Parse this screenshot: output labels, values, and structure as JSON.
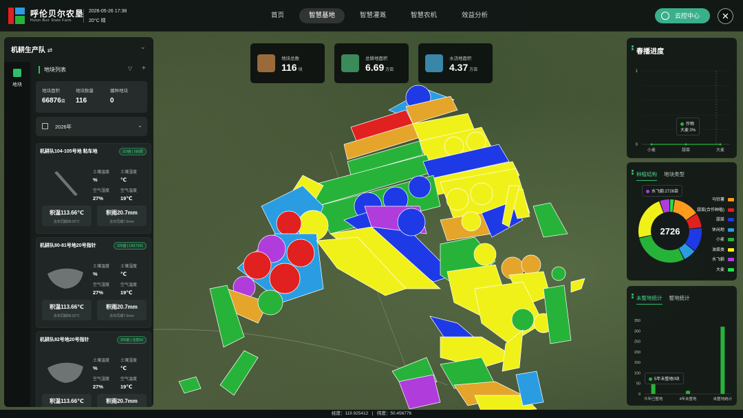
{
  "header": {
    "brand_cn": "呼伦贝尔农垦",
    "brand_en": "Hulun Buir State Farm",
    "datetime": "2026-05-26 17:38",
    "weather": "20°C 晴",
    "nav": [
      "首页",
      "智慧基地",
      "智慧灌溉",
      "智慧农机",
      "效益分析"
    ],
    "active_nav": "智慧基地",
    "cloud_label": "云控中心",
    "close_symbol": "✕"
  },
  "left": {
    "team_title": "机耕生产队",
    "sidebar_tab": "地块",
    "list_title": "地块列表",
    "stats": [
      {
        "label": "地块面积",
        "value": "66876",
        "unit": "亩"
      },
      {
        "label": "地块数量",
        "value": "116",
        "unit": ""
      },
      {
        "label": "播种地块",
        "value": "0",
        "unit": ""
      }
    ],
    "year": "2026年",
    "cards": [
      {
        "title": "机耕队104-105号地 粘车地",
        "badge": "119亩 | 0|0|局",
        "soil_temp_label": "土壤温度",
        "soil_temp": "%",
        "soil_hum_label": "土壤湿度",
        "soil_hum": "℃",
        "air_hum_label": "空气湿度",
        "air_hum": "27%",
        "air_temp_label": "空气温度",
        "air_temp": "19℃",
        "acc_temp": "积温113.66℃",
        "acc_temp_last": "去年同期98.92℃",
        "acc_rain": "积雨20.7mm",
        "acc_rain_last": "去年同期7.5mm"
      },
      {
        "title": "机耕队80-81号地20号指针",
        "badge": "225亩 | LN17101",
        "soil_temp_label": "土壤温度",
        "soil_temp": "%",
        "soil_hum_label": "土壤湿度",
        "soil_hum": "℃",
        "air_hum_label": "空气湿度",
        "air_hum": "27%",
        "air_temp_label": "空气温度",
        "air_temp": "19℃",
        "acc_temp": "积温113.66℃",
        "acc_temp_last": "去年同期98.92℃",
        "acc_rain": "积雨20.7mm",
        "acc_rain_last": "去年同期7.5mm"
      },
      {
        "title": "机耕队82号地20号指针",
        "badge": "255亩 | 北宏60",
        "soil_temp_label": "土壤温度",
        "soil_temp": "%",
        "soil_hum_label": "土壤湿度",
        "soil_hum": "℃",
        "air_hum_label": "空气湿度",
        "air_hum": "27%",
        "air_temp_label": "空气温度",
        "air_temp": "19℃",
        "acc_temp": "积温113.66℃",
        "acc_temp_last": "去年同期98.92℃",
        "acc_rain": "积雨20.7mm",
        "acc_rain_last": "去年同期7.5mm"
      }
    ]
  },
  "kpis": [
    {
      "label": "地块总数",
      "value": "116",
      "unit": "块",
      "color": "#9a6a3a"
    },
    {
      "label": "总耕地面积",
      "value": "6.69",
      "unit": "万亩",
      "color": "#3b8a5a"
    },
    {
      "label": "水浇地面积",
      "value": "4.37",
      "unit": "万亩",
      "color": "#3a86a8"
    }
  ],
  "spring": {
    "title": "春播进度",
    "tooltip_series": "作物",
    "tooltip_value": "大麦:0%"
  },
  "structure": {
    "tabs": [
      "种植结构",
      "地块类型"
    ],
    "tooltip": "水飞蓟:2726亩",
    "center_value": "2726",
    "colors": {
      "马铃薯": "#ff9a1c",
      "甜菜(合作种植)": "#e12020",
      "甜菜": "#1e3ae6",
      "休闲地": "#2a9de2",
      "小麦": "#27b339",
      "油菜类": "#f1f11a",
      "水飞蓟": "#b03cdc",
      "大麦": "#22e04c"
    }
  },
  "fallow": {
    "tabs": [
      "未整地统计",
      "整地统计"
    ],
    "tooltip": "5年未整地0块"
  },
  "chart_data": [
    {
      "type": "line",
      "title": "春播进度",
      "categories": [
        "小麦",
        "甜菜",
        "大麦"
      ],
      "series": [
        {
          "name": "作物",
          "values": [
            0,
            0,
            0
          ]
        }
      ],
      "ylim": [
        0,
        1
      ],
      "yticks": [
        "0",
        "0.2",
        "0.4",
        "0.6",
        "0.8",
        "1"
      ]
    },
    {
      "type": "pie",
      "title": "种植结构",
      "labels": [
        "马铃薯",
        "甜菜(合作种植)",
        "甜菜",
        "休闲地",
        "小麦",
        "油菜类",
        "水飞蓟",
        "大麦"
      ],
      "values": [
        7000,
        4000,
        6500,
        3500,
        15000,
        12000,
        2726,
        1200
      ]
    },
    {
      "type": "bar",
      "categories": [
        "今年已整地",
        "",
        "4年未整地",
        "",
        "未整地统计"
      ],
      "values": [
        80,
        0,
        15,
        0,
        320
      ],
      "ylim": [
        0,
        350
      ],
      "yticks": [
        "0",
        "50",
        "100",
        "150",
        "200",
        "250",
        "300",
        "350"
      ]
    }
  ],
  "status": {
    "lng_label": "经度：",
    "lng": "119.925412",
    "lat_label": "纬度：",
    "lat": "50.456776"
  }
}
